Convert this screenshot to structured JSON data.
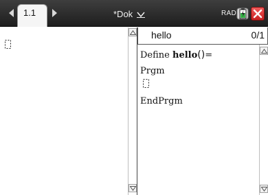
{
  "top_bar": {
    "tab_label": "1.1",
    "doc_title": "*Dok",
    "angle_mode": "RAD"
  },
  "editor": {
    "program_name": "hello",
    "line_counter": "0/1",
    "code": {
      "define_keyword": "Define ",
      "define_name": "hello",
      "define_parens": "()",
      "define_equals": "=",
      "prgm": "Prgm",
      "endprgm": "EndPrgm"
    }
  },
  "icons": {
    "tab_left": "triangle-left",
    "tab_right": "triangle-right",
    "doc_menu": "chevron-down",
    "battery": "battery-charging",
    "close": "x-mark",
    "scroll_up": "triangle-up",
    "scroll_down": "triangle-down",
    "empty_entry": "dashed-box"
  },
  "colors": {
    "top_bar": "#2b2b2b",
    "close_red": "#d93030",
    "battery_green": "#39b54a"
  }
}
